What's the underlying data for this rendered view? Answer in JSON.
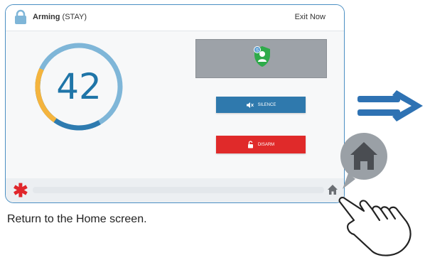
{
  "header": {
    "title_bold": "Arming",
    "title_rest": " (STAY)",
    "exit_label": "Exit Now"
  },
  "countdown": {
    "value": "42",
    "elapsed_fraction": 0.18
  },
  "status_panel": {
    "icon": "shield-user-icon",
    "badge": "S"
  },
  "buttons": {
    "silence_label": "SILENCE",
    "disarm_label": "DISARM"
  },
  "footer": {
    "left_icon": "emergency-asterisk-icon",
    "right_icon": "home-icon"
  },
  "caption": "Return to the Home screen.",
  "colors": {
    "accent_blue": "#2f79ad",
    "ring_light": "#7fb6d8",
    "ring_dark": "#2e7bb0",
    "ring_elapsed": "#f4b43e",
    "disarm_red": "#e02a2a",
    "shield_green": "#2eab4a",
    "arrow_blue": "#2e72b3"
  }
}
